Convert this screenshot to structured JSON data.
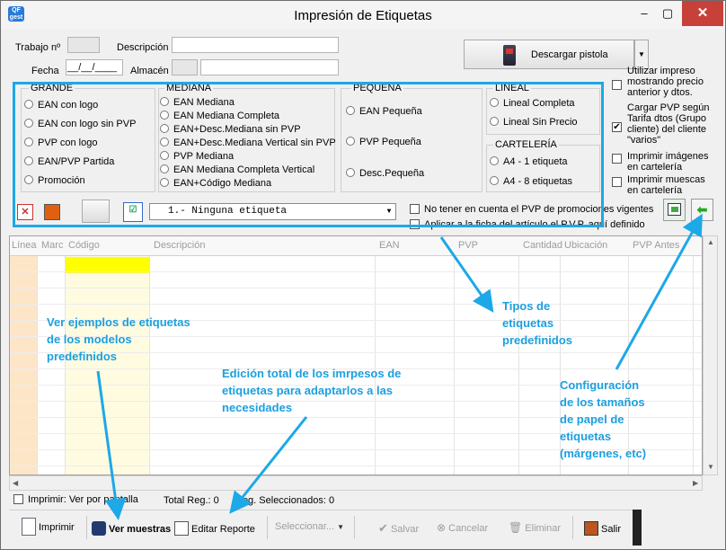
{
  "window": {
    "app_icon": "QF gest",
    "title": "Impresión de Etiquetas",
    "min": "–",
    "max": "▢",
    "close": "✕"
  },
  "header": {
    "trabajo_label": "Trabajo nº",
    "descripcion_label": "Descripción",
    "fecha_label": "Fecha",
    "fecha_value": "__/__/____",
    "almacen_label": "Almacén",
    "pistola_label": "Descargar pistola"
  },
  "groups": {
    "grande": {
      "title": "GRANDE",
      "options": [
        "EAN con logo",
        "EAN con logo sin PVP",
        "PVP con logo",
        "EAN/PVP Partida",
        "Promoción"
      ]
    },
    "mediana": {
      "title": "MEDIANA",
      "options": [
        "EAN Mediana",
        "EAN Mediana Completa",
        "EAN+Desc.Mediana sin PVP",
        "EAN+Desc.Mediana Vertical sin PVP",
        "PVP Mediana",
        "EAN Mediana Completa Vertical",
        "EAN+Código Mediana"
      ]
    },
    "pequena": {
      "title": "PEQUEÑA",
      "options": [
        "EAN Pequeña",
        "PVP Pequeña",
        "Desc.Pequeña"
      ]
    },
    "lineal": {
      "title": "LINEAL",
      "options": [
        "Lineal Completa",
        "Lineal Sin Precio"
      ]
    },
    "carteleria": {
      "title": "CARTELERÍA",
      "options": [
        "A4 - 1 etiqueta",
        "A4 - 8 etiquetas"
      ]
    }
  },
  "right_options": {
    "utilizar": "Utilizar impreso mostrando precio anterior y dtos. (...)",
    "cargar": "Cargar PVP según Tarifa dtos (Grupo cliente) del cliente \"varios\"",
    "imagenes": "Imprimir imágenes en cartelería",
    "muescas": "Imprimir muescas en cartelería"
  },
  "toolbar": {
    "combo_value": "1.- Ninguna etiqueta",
    "no_tener": "No tener en cuenta el PVP de promociones vigentes",
    "aplicar": "Aplicar a la ficha del artículo el P.V.P. aquí definido"
  },
  "grid": {
    "columns": [
      "Línea",
      "Marc",
      "Código",
      "Descripción",
      "EAN",
      "PVP",
      "Cantidad",
      "Ubicación",
      "PVP Antes"
    ]
  },
  "status": {
    "imprimir_pantalla": "Imprimir: Ver por pantalla",
    "total_reg": "Total Reg.: 0",
    "reg_sel": "Reg. Seleccionados: 0"
  },
  "bottom": {
    "imprimir": "Imprimir",
    "ver_muestras": "Ver muestras",
    "editar": "Editar Reporte",
    "seleccionar": "Seleccionar...",
    "salvar": "Salvar",
    "cancelar": "Cancelar",
    "eliminar": "Eliminar",
    "salir": "Salir"
  },
  "annotations": {
    "tipos": [
      "Tipos de",
      "etiquetas",
      "predefinidos"
    ],
    "ejemplos": [
      "Ver ejemplos de etiquetas",
      "de los modelos",
      "predefinidos"
    ],
    "edicion": [
      "Edición total de los imrpesos de",
      "etiquetas para adaptarlos a las",
      "necesidades"
    ],
    "config": [
      "Configuración",
      "de los tamaños",
      "de papel de",
      "etiquetas",
      "(márgenes, etc)"
    ]
  },
  "colors": {
    "highlight": "#1da8e8",
    "annotation": "#1b9fe0",
    "code_col": "#fffbe0",
    "code_cell": "#ffff00",
    "line_col": "#fde6c8"
  }
}
